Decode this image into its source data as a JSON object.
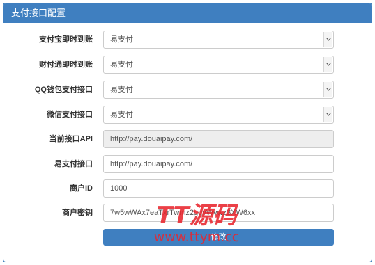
{
  "panel": {
    "title": "支付接口配置"
  },
  "form": {
    "fields": [
      {
        "label": "支付宝即时到账",
        "value": "易支付",
        "type": "select"
      },
      {
        "label": "财付通即时到账",
        "value": "易支付",
        "type": "select"
      },
      {
        "label": "QQ钱包支付接口",
        "value": "易支付",
        "type": "select"
      },
      {
        "label": "微信支付接口",
        "value": "易支付",
        "type": "select"
      },
      {
        "label": "当前接口API",
        "value": "http://pay.douaipay.com/",
        "type": "readonly"
      },
      {
        "label": "易支付接口",
        "value": "http://pay.douaipay.com/",
        "type": "input"
      },
      {
        "label": "商户ID",
        "value": "1000",
        "type": "input"
      },
      {
        "label": "商户密钥",
        "value": "7w5wWAx7eaTxrTwmz2ggvWvwz3XW6xx",
        "type": "input"
      }
    ],
    "submit_label": "修改"
  },
  "watermark": {
    "line1": "TT源码",
    "line2": "www.ttym.cc"
  },
  "colors": {
    "header": "#3f7fc0",
    "button": "#3f7fc0",
    "watermark": "#e8262d"
  }
}
